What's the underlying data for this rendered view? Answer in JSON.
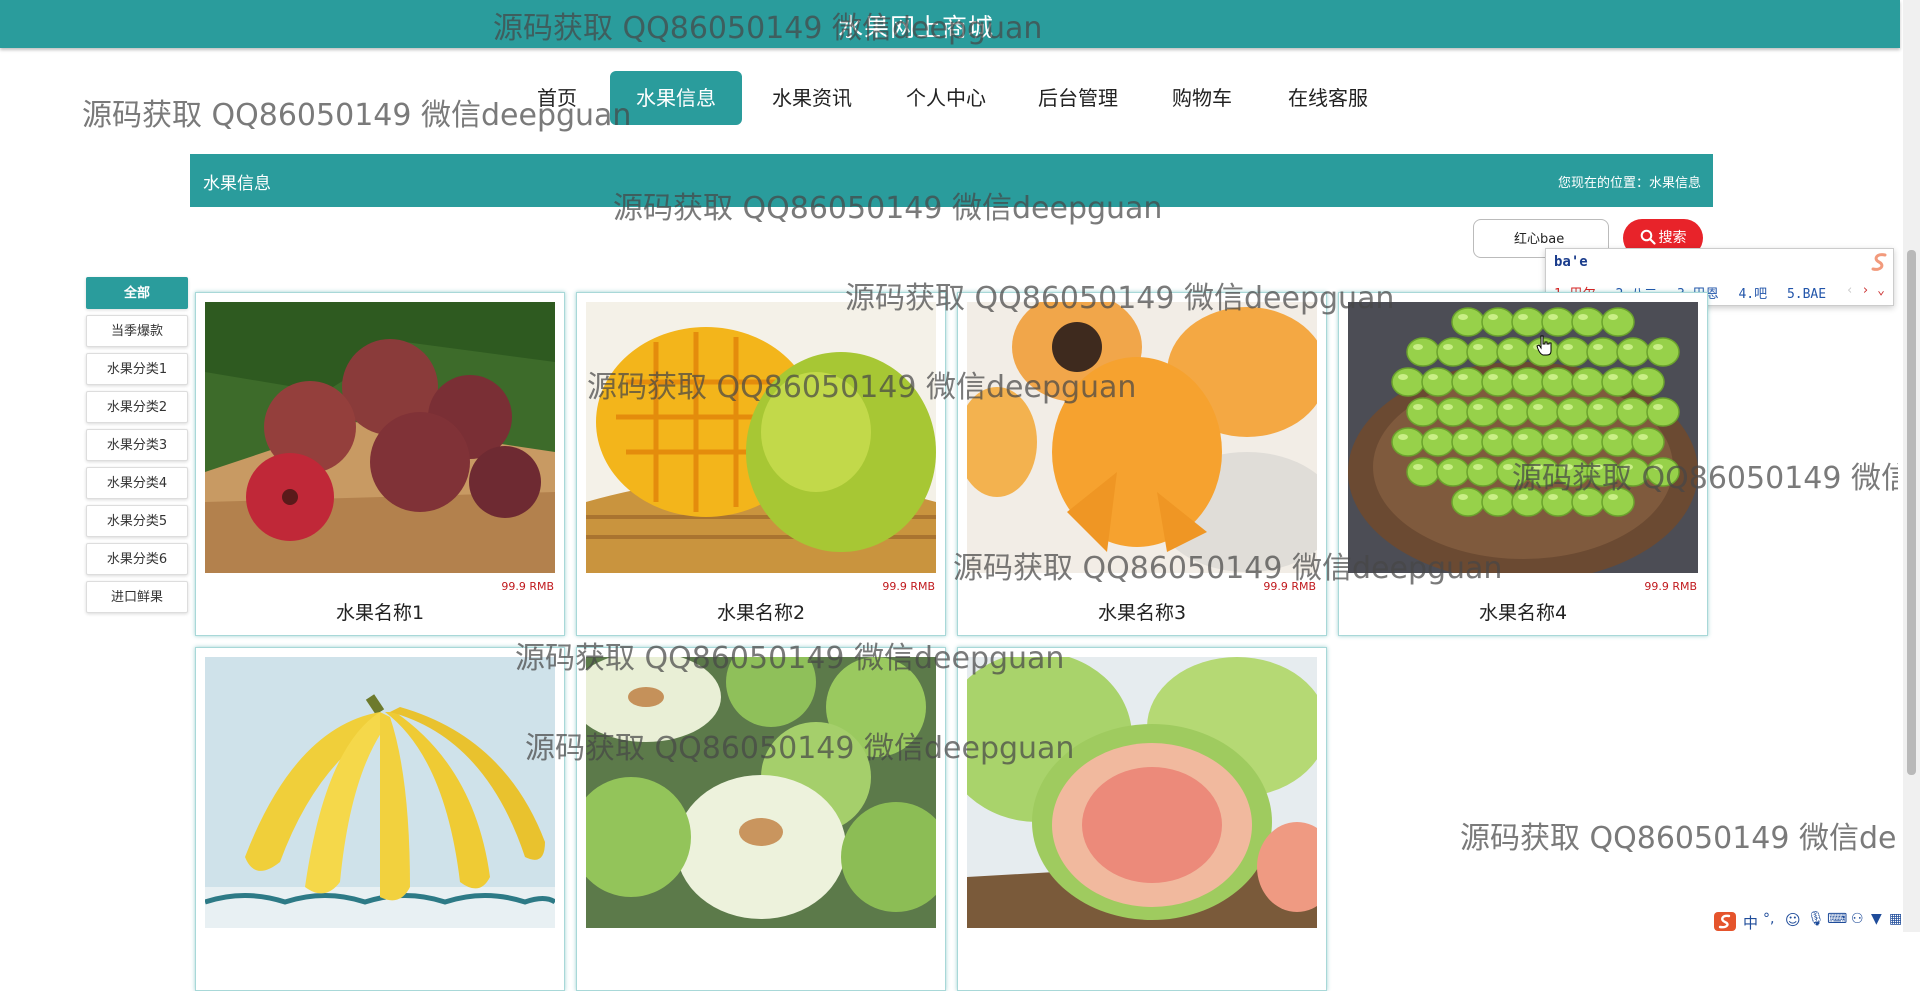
{
  "site": {
    "title": "水果网上商城"
  },
  "nav": {
    "items": [
      "首页",
      "水果信息",
      "水果资讯",
      "个人中心",
      "后台管理",
      "购物车",
      "在线客服"
    ],
    "active": "水果信息"
  },
  "info_bar": {
    "title": "水果信息",
    "location": "您现在的位置：水果信息"
  },
  "search": {
    "value": "红心bae",
    "button_label": "搜索"
  },
  "ime": {
    "composition": "ba'e",
    "candidates": [
      "1.巴尔",
      "2.八二",
      "3.巴恩",
      "4.吧",
      "5.BAE"
    ]
  },
  "sidebar": {
    "items": [
      "全部",
      "当季爆款",
      "水果分类1",
      "水果分类2",
      "水果分类3",
      "水果分类4",
      "水果分类5",
      "水果分类6",
      "进口鲜果"
    ],
    "active": "全部"
  },
  "products": [
    {
      "name": "水果名称1",
      "price": "99.9 RMB",
      "image": "plum"
    },
    {
      "name": "水果名称2",
      "price": "99.9 RMB",
      "image": "mango"
    },
    {
      "name": "水果名称3",
      "price": "99.9 RMB",
      "image": "loquat"
    },
    {
      "name": "水果名称4",
      "price": "99.9 RMB",
      "image": "green-grapes"
    },
    {
      "name": "",
      "price": "",
      "image": "banana"
    },
    {
      "name": "",
      "price": "",
      "image": "green-jujube"
    },
    {
      "name": "",
      "price": "",
      "image": "guava"
    }
  ],
  "watermark": "源码获取 QQ86050149 微信deepguan",
  "colors": {
    "accent": "#2a9c9c",
    "search_button": "#e8232a",
    "price": "#c0191d"
  },
  "tray": {
    "ime_mode": "中"
  }
}
